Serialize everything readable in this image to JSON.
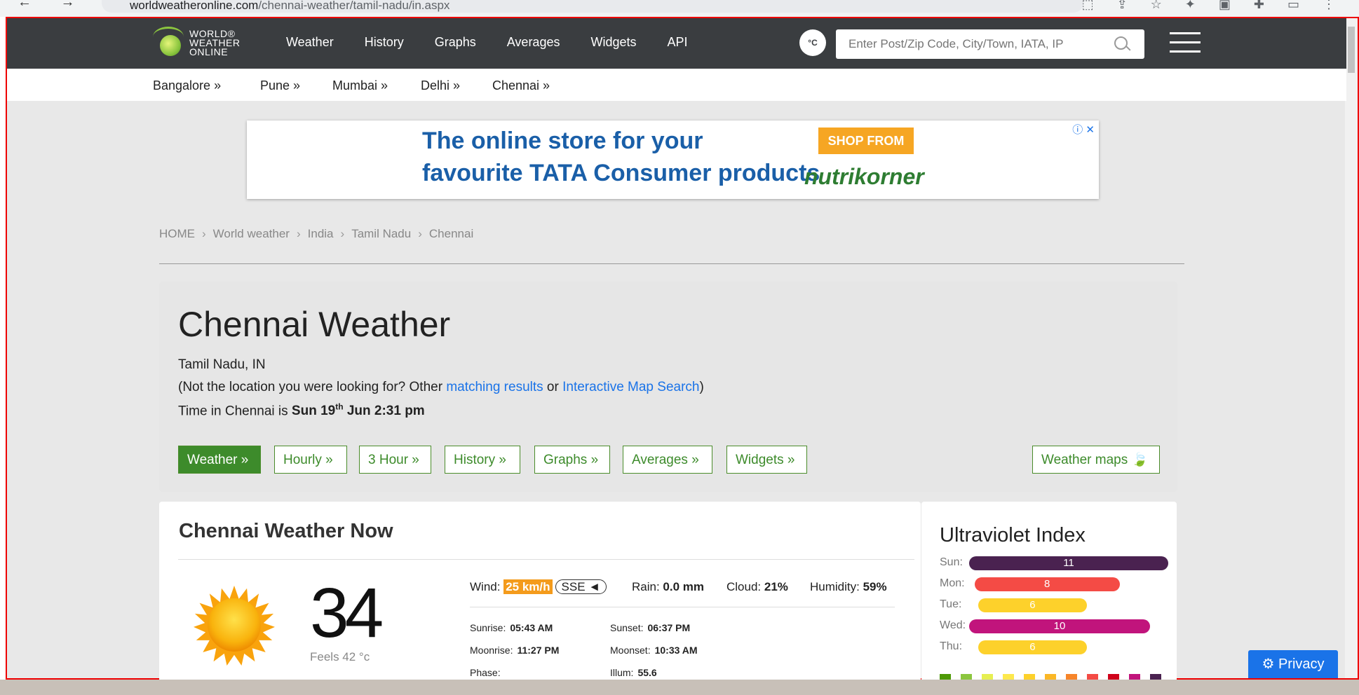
{
  "browser": {
    "nav_icons": "←  →  C",
    "url_host": "worldweatheronline.com",
    "url_path": "/chennai-weather/tamil-nadu/in.aspx",
    "ext_icons": "⬚ ⇪ ☆ ✦ ▣ ✚ ▭ ⋮"
  },
  "nav": {
    "logo_line1": "WORLD®",
    "logo_line2": "WEATHER",
    "logo_line3": "ONLINE",
    "items": [
      "Weather",
      "History",
      "Graphs",
      "Averages",
      "Widgets",
      "API"
    ],
    "unit_label": "°C",
    "search_placeholder": "Enter Post/Zip Code, City/Town, IATA, IP"
  },
  "citybar": [
    "Bangalore »",
    "Pune »",
    "Mumbai »",
    "Delhi »",
    "Chennai »"
  ],
  "ad": {
    "line1": "The online store for your",
    "line2": "favourite TATA Consumer products",
    "cta": "SHOP FROM",
    "brand": "nutrikorner",
    "close": "ⓘ ✕"
  },
  "breadcrumb": [
    "HOME",
    "World weather",
    "India",
    "Tamil Nadu",
    "Chennai"
  ],
  "location": {
    "title": "Chennai Weather",
    "region": "Tamil Nadu, IN",
    "not_loc_prefix": "(Not the location you were looking for? Other ",
    "link_matching": "matching results",
    "or_text": " or ",
    "link_map": "Interactive Map Search",
    "close_paren": ")",
    "time_prefix": "Time in Chennai is ",
    "time_day": "Sun 19",
    "time_sup": "th",
    "time_rest": " Jun 2:31 pm"
  },
  "tabs": [
    "Weather »",
    "Hourly »",
    "3 Hour »",
    "History »",
    "Graphs »",
    "Averages »",
    "Widgets »",
    "Weather maps 🍃"
  ],
  "now": {
    "title": "Chennai Weather Now",
    "temp": "34",
    "feels": "Feels 42 °c",
    "wind_label": "Wind:",
    "wind_value": "25 km/h",
    "wind_dir": "SSE ◄",
    "rain_label": "Rain:",
    "rain_value": "0.0 mm",
    "cloud_label": "Cloud:",
    "cloud_value": "21%",
    "humidity_label": "Humidity:",
    "humidity_value": "59%",
    "sunrise_label": "Sunrise:",
    "sunrise": "05:43 AM",
    "sunset_label": "Sunset:",
    "sunset": "06:37 PM",
    "moonrise_label": "Moonrise:",
    "moonrise": "11:27 PM",
    "moonset_label": "Moonset:",
    "moonset": "10:33 AM",
    "phase_label": "Phase:",
    "illum_label": "Illum:",
    "illum": "55.6"
  },
  "uv": {
    "title": "Ultraviolet Index",
    "days": [
      {
        "day": "Sun:",
        "value": "11",
        "color": "#4a2250"
      },
      {
        "day": "Mon:",
        "value": "8",
        "color": "#f44b45"
      },
      {
        "day": "Tue:",
        "value": "6",
        "color": "#fdd12b"
      },
      {
        "day": "Wed:",
        "value": "10",
        "color": "#c1147c"
      },
      {
        "day": "Thu:",
        "value": "6",
        "color": "#fdd12b"
      }
    ],
    "scale_colors": [
      "#4e9a06",
      "#8cc63f",
      "#e6ef52",
      "#fde84d",
      "#fdd12b",
      "#fbb726",
      "#f7852a",
      "#f44b45",
      "#d0021b",
      "#c1147c",
      "#4a2250"
    ]
  },
  "privacy": "⚙ Privacy"
}
